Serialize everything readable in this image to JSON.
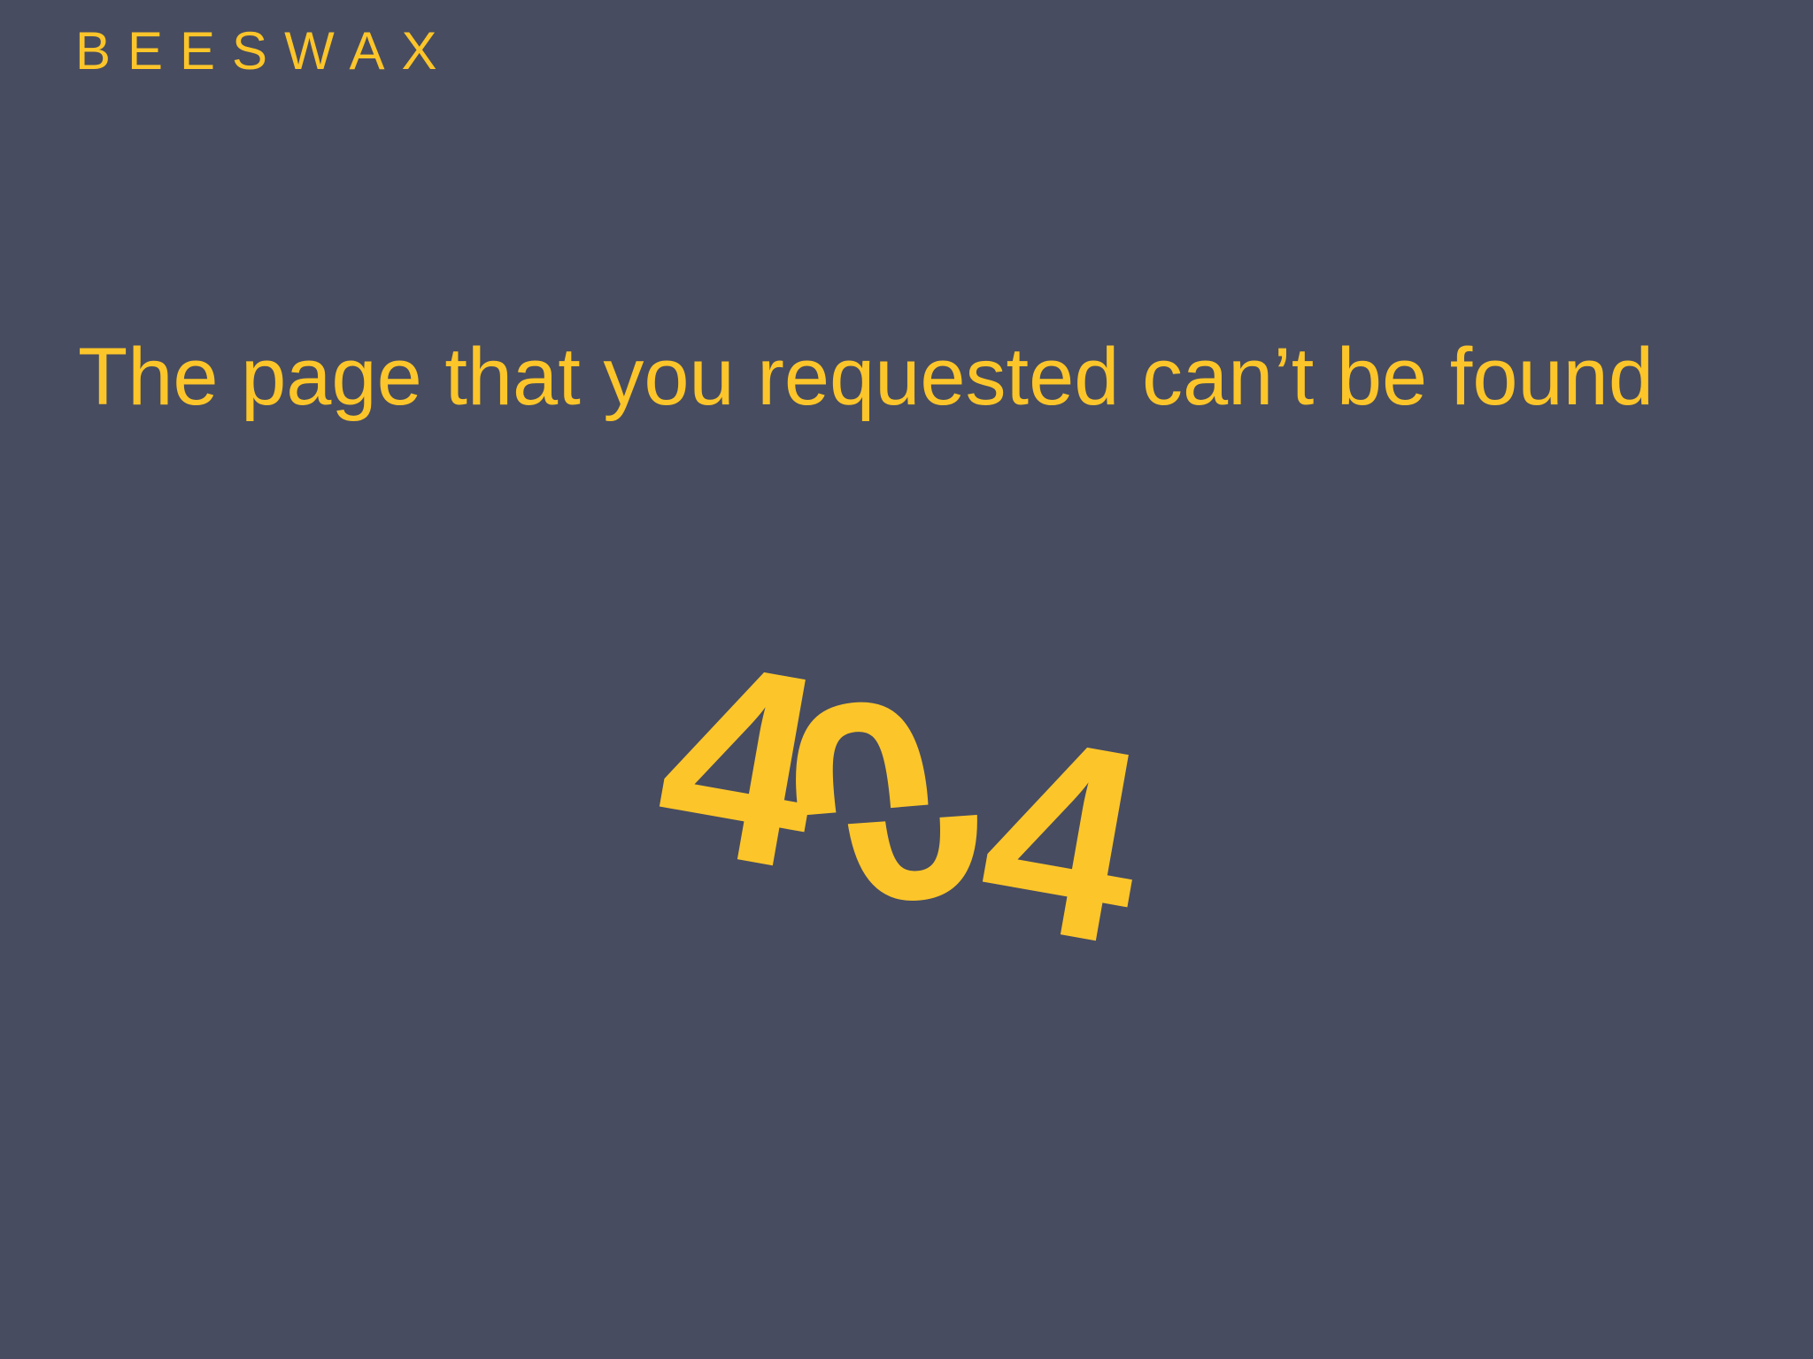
{
  "header": {
    "brand": "BEESWAX"
  },
  "main": {
    "message": "The page that you requested can’t be found",
    "error_code": {
      "digit_1": "4",
      "digit_2": "0",
      "digit_3": "4"
    }
  },
  "colors": {
    "background": "#474c60",
    "accent": "#fcc52a"
  }
}
